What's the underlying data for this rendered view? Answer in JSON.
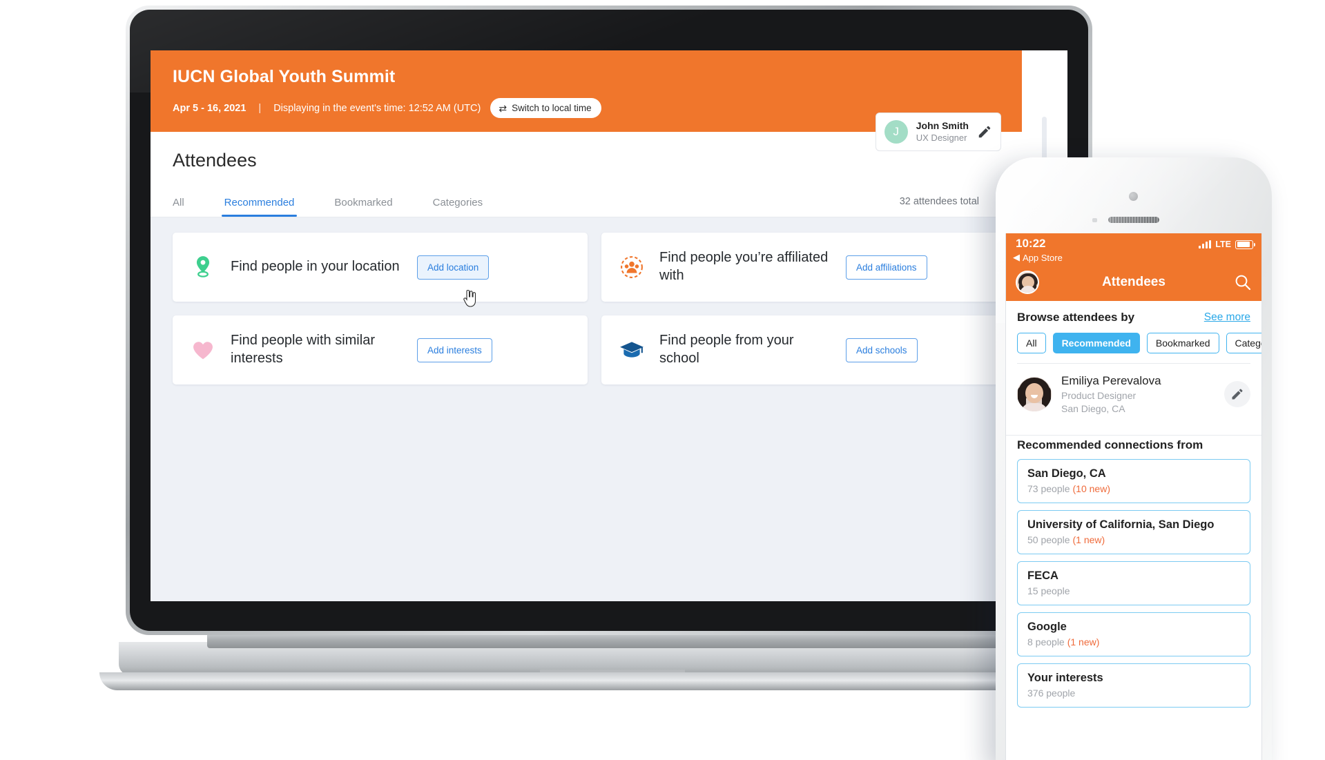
{
  "desktop": {
    "event": {
      "title": "IUCN Global Youth Summit",
      "dates": "Apr 5 - 16, 2021",
      "separator": "|",
      "time_display": "Displaying in the event's time: 12:52 AM (UTC)",
      "switch_button": "Switch to local time",
      "switch_icon": "⇄",
      "header_color": "#f0762c"
    },
    "page_title": "Attendees",
    "profile": {
      "initial": "J",
      "name": "John Smith",
      "role": "UX Designer",
      "edit_icon": "pencil-icon",
      "avatar_color": "#a3ddc6"
    },
    "tabs": [
      {
        "label": "All",
        "active": false
      },
      {
        "label": "Recommended",
        "active": true
      },
      {
        "label": "Bookmarked",
        "active": false
      },
      {
        "label": "Categories",
        "active": false
      }
    ],
    "attendee_total": "32 attendees total",
    "accent_blue": "#2a7ede",
    "cards": [
      {
        "title": "Find people in your location",
        "button": "Add location",
        "icon": "location-pin-icon",
        "icon_color": "#3ecf8e",
        "focused": true
      },
      {
        "title": "Find people you’re affiliated with",
        "button": "Add affiliations",
        "icon": "people-group-icon",
        "icon_color": "#f0762c",
        "focused": false
      },
      {
        "title": "Find people with similar interests",
        "button": "Add interests",
        "icon": "heart-icon",
        "icon_color": "#f6b7ce",
        "focused": false
      },
      {
        "title": "Find people from your school",
        "button": "Add schools",
        "icon": "graduation-cap-icon",
        "icon_color": "#15558f",
        "focused": false
      }
    ]
  },
  "phone": {
    "status": {
      "time": "10:22",
      "back_label": "App Store",
      "back_icon": "◀",
      "network": "LTE",
      "signal_icon": "signal-bars-icon",
      "battery_icon": "battery-icon"
    },
    "nav": {
      "title": "Attendees",
      "avatar_icon": "user-avatar",
      "search_icon": "search-icon"
    },
    "browse": {
      "label": "Browse attendees by",
      "see_more": "See more",
      "chips": [
        {
          "label": "All",
          "active": false
        },
        {
          "label": "Recommended",
          "active": true
        },
        {
          "label": "Bookmarked",
          "active": false
        },
        {
          "label": "Categories",
          "active": false
        }
      ]
    },
    "person": {
      "name": "Emiliya Perevalova",
      "role": "Product Designer",
      "location": "San Diego, CA",
      "edit_icon": "pencil-icon"
    },
    "recommended_heading": "Recommended connections from",
    "connections": [
      {
        "title": "San Diego, CA",
        "people": "73 people",
        "new": "(10 new)"
      },
      {
        "title": "University of California, San Diego",
        "people": "50 people",
        "new": "(1 new)"
      },
      {
        "title": "FECA",
        "people": "15 people",
        "new": ""
      },
      {
        "title": "Google",
        "people": "8 people",
        "new": "(1 new)"
      },
      {
        "title": "Your interests",
        "people": "376 people",
        "new": ""
      }
    ],
    "accent_blue": "#3fb3ef",
    "new_color": "#ef6a3a"
  }
}
